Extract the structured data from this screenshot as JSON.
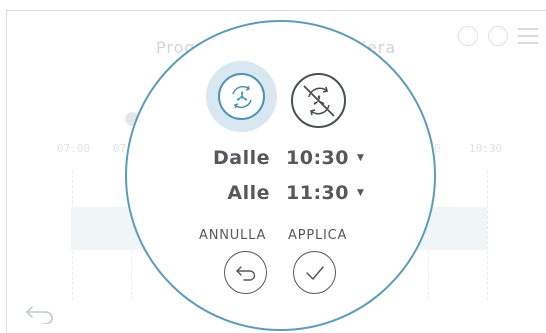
{
  "background": {
    "title_left": "Prog",
    "title_right": "liera",
    "time_ticks": [
      "07:00",
      "07",
      "0",
      "10:30"
    ]
  },
  "popup": {
    "modes": [
      {
        "icon": "fan-auto-icon",
        "selected": true
      },
      {
        "icon": "fan-off-icon",
        "selected": false
      }
    ],
    "from_label": "Dalle",
    "from_value": "10:30",
    "to_label": "Alle",
    "to_value": "11:30",
    "cancel_label": "ANNULLA",
    "apply_label": "APPLICA"
  },
  "colors": {
    "accent": "#5e9bbb",
    "accent_fill": "#d8e7f0",
    "text": "#55595c"
  }
}
